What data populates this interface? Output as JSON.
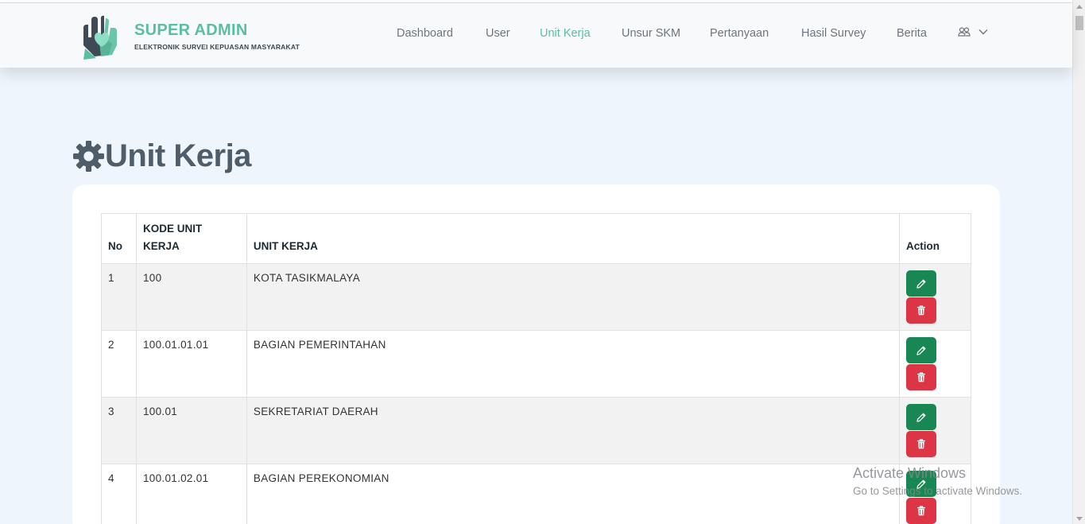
{
  "brand": {
    "title": "SUPER ADMIN",
    "subtitle": "ELEKTRONIK SURVEI KEPUASAN MASYARAKAT",
    "logo_icon": "hands-heart-icon"
  },
  "nav": {
    "items": [
      {
        "label": "Dashboard",
        "active": false
      },
      {
        "label": "User",
        "active": false
      },
      {
        "label": "Unit Kerja",
        "active": true
      },
      {
        "label": "Unsur SKM",
        "active": false
      },
      {
        "label": "Pertanyaan",
        "active": false
      },
      {
        "label": "Hasil Survey",
        "active": false
      },
      {
        "label": "Berita",
        "active": false
      }
    ],
    "user_icon": "users-icon",
    "dropdown_icon": "chevron-down-icon"
  },
  "page": {
    "title": "Unit Kerja",
    "title_icon": "gear-icon"
  },
  "table": {
    "headers": {
      "no": "No",
      "kode": "KODE UNIT KERJA",
      "unit": "UNIT KERJA",
      "action": "Action"
    },
    "rows": [
      {
        "no": "1",
        "kode": "100",
        "unit": "KOTA TASIKMALAYA"
      },
      {
        "no": "2",
        "kode": "100.01.01.01",
        "unit": "BAGIAN PEMERINTAHAN"
      },
      {
        "no": "3",
        "kode": "100.01",
        "unit": "SEKRETARIAT DAERAH"
      },
      {
        "no": "4",
        "kode": "100.01.02.01",
        "unit": "BAGIAN PEREKONOMIAN"
      }
    ],
    "edit_icon": "pencil-icon",
    "delete_icon": "trash-icon"
  },
  "watermark": {
    "title": "Activate Windows",
    "subtitle": "Go to Settings to activate Windows."
  },
  "colors": {
    "accent": "#5bbf9f",
    "edit": "#198754",
    "delete": "#dc3545",
    "background": "#eef5fd"
  }
}
